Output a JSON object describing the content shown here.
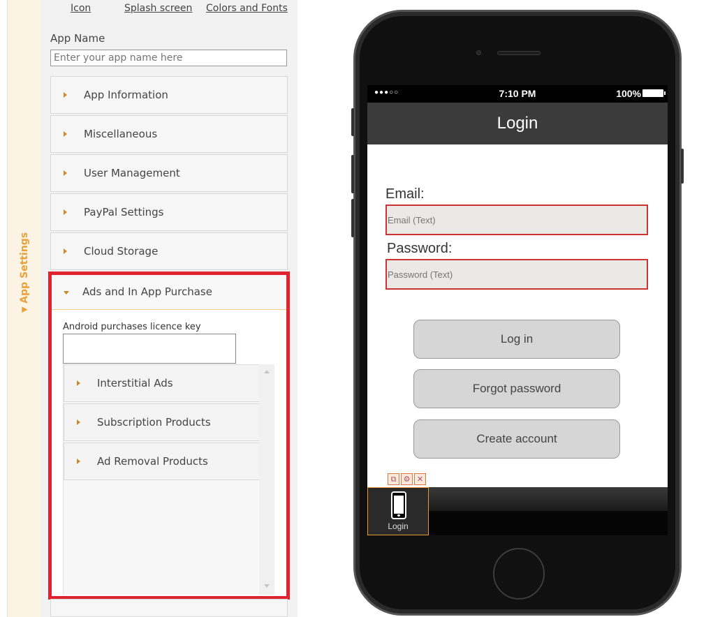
{
  "sidebar_tab": {
    "label": "App Settings"
  },
  "panel": {
    "links": [
      "Icon",
      "Splash screen",
      "Colors and Fonts"
    ],
    "app_name": {
      "label": "App Name",
      "placeholder": "Enter your app name here"
    },
    "sections": [
      {
        "label": "App Information"
      },
      {
        "label": "Miscellaneous"
      },
      {
        "label": "User Management"
      },
      {
        "label": "PayPal Settings"
      },
      {
        "label": "Cloud Storage"
      }
    ],
    "open_section": {
      "label": "Ads and In App Purchase",
      "licence_label": "Android purchases licence key",
      "subsections": [
        {
          "label": "Interstitial Ads"
        },
        {
          "label": "Subscription Products"
        },
        {
          "label": "Ad Removal Products"
        }
      ]
    }
  },
  "phone": {
    "status": {
      "signal": "●●●○○",
      "time": "7:10 PM",
      "battery": "100%"
    },
    "nav_title": "Login",
    "email_label": "Email:",
    "email_placeholder": "Email (Text)",
    "password_label": "Password:",
    "password_placeholder": "Password (Text)",
    "buttons": [
      "Log in",
      "Forgot password",
      "Create account"
    ],
    "tab_label": "Login",
    "tool_icons": [
      "copy-icon",
      "settings-icon",
      "close-icon"
    ]
  },
  "colors": {
    "accent": "#e9a23b",
    "highlight_border": "#e0232e",
    "input_border": "#cc3333"
  }
}
